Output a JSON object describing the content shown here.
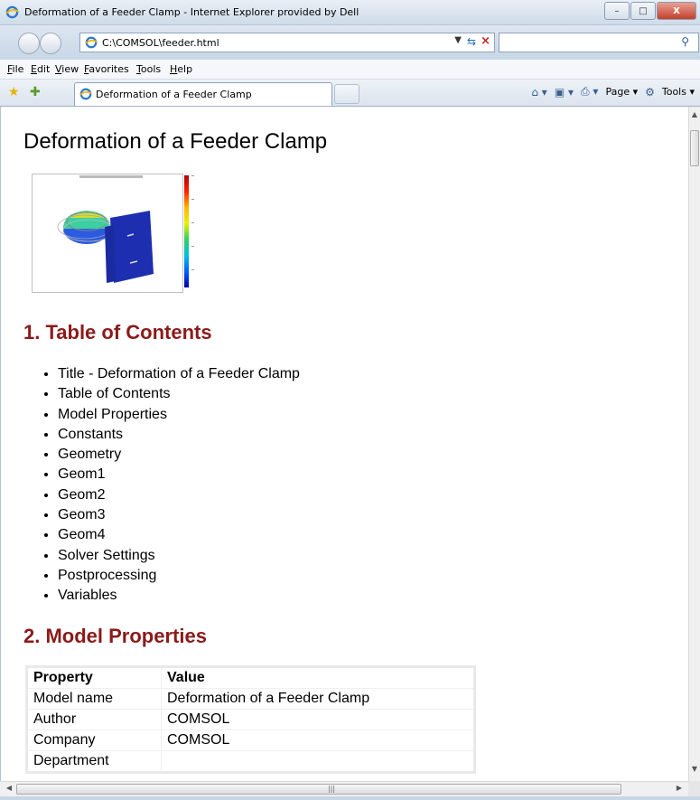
{
  "window": {
    "title": "Deformation of a Feeder Clamp - Internet Explorer provided by Dell",
    "minimize": "–",
    "maximize": "□",
    "close": "X"
  },
  "address": {
    "url": "C:\\COMSOL\\feeder.html",
    "search_placeholder": ""
  },
  "menu": [
    "File",
    "Edit",
    "View",
    "Favorites",
    "Tools",
    "Help"
  ],
  "tab": {
    "title": "Deformation of a Feeder Clamp"
  },
  "commandbar": {
    "page": "Page ▾",
    "tools": "Tools ▾"
  },
  "document": {
    "title": "Deformation of a Feeder Clamp",
    "section1": "1. Table of Contents",
    "toc": [
      "Title - Deformation of a Feeder Clamp",
      "Table of Contents",
      "Model Properties",
      "Constants",
      "Geometry",
      "Geom1",
      "Geom2",
      "Geom3",
      "Geom4",
      "Solver Settings",
      "Postprocessing",
      "Variables"
    ],
    "section2": "2. Model Properties",
    "table": {
      "headers": [
        "Property",
        "Value"
      ],
      "rows": [
        [
          "Model name",
          "Deformation of a Feeder Clamp"
        ],
        [
          "Author",
          "COMSOL"
        ],
        [
          "Company",
          "COMSOL"
        ],
        [
          "Department",
          ""
        ]
      ]
    }
  },
  "colors": {
    "heading": "#8b1a1a",
    "link": "#000000"
  }
}
